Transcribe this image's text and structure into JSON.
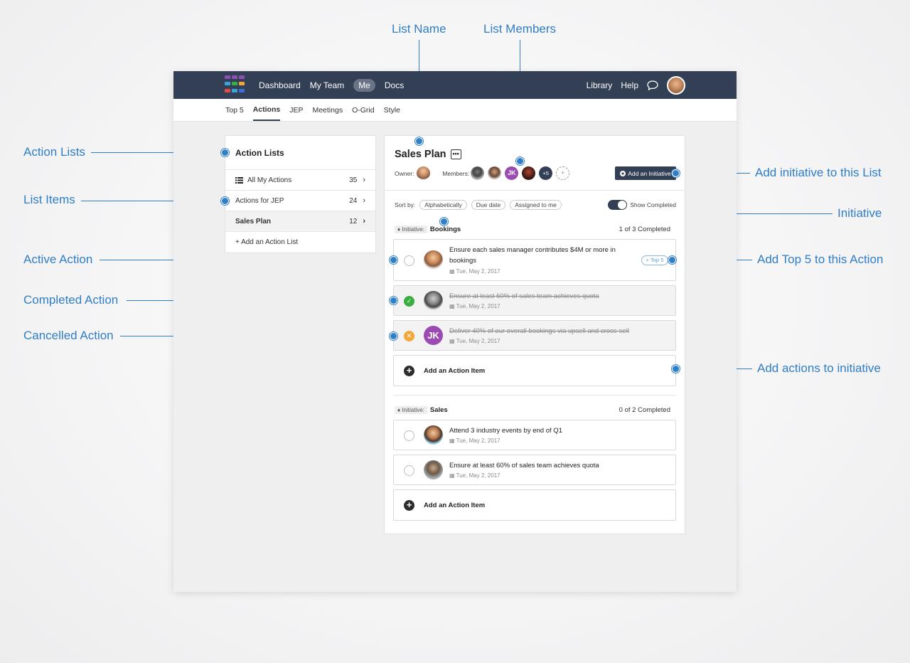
{
  "callouts": {
    "list_name": "List Name",
    "list_members": "List Members",
    "action_lists": "Action Lists",
    "list_items": "List Items",
    "active_action": "Active Action",
    "completed_action": "Completed Action",
    "cancelled_action": "Cancelled Action",
    "add_initiative": "Add initiative to this List",
    "initiative": "Initiative",
    "add_top5": "Add Top 5 to this Action",
    "add_actions": "Add actions to initiative"
  },
  "colors": {
    "accent": "#2f7ec6",
    "navbar": "#333f55",
    "complete": "#3aae3f",
    "cancel": "#f3a73a",
    "member_jk": "#9b4ab2"
  },
  "topnav": {
    "items": [
      "Dashboard",
      "My Team",
      "Me",
      "Docs"
    ],
    "active": "Me",
    "right": {
      "library": "Library",
      "help": "Help"
    }
  },
  "subnav": {
    "items": [
      "Top 5",
      "Actions",
      "JEP",
      "Meetings",
      "O-Grid",
      "Style"
    ],
    "active": "Actions"
  },
  "action_lists": {
    "title": "Action Lists",
    "items": [
      {
        "label": "All My Actions",
        "count": "35",
        "icon": "list-icon"
      },
      {
        "label": "Actions for JEP",
        "count": "24"
      },
      {
        "label": "Sales Plan",
        "count": "12",
        "selected": true
      }
    ],
    "add_label": "+ Add an Action List"
  },
  "list": {
    "name": "Sales Plan",
    "owner_label": "Owner:",
    "members_label": "Members:",
    "member_initials": "JK",
    "more_members": "+5",
    "add_initiative_label": "Add an Initiative",
    "sort_label": "Sort by:",
    "sort_options": [
      "Alphabetically",
      "Due date",
      "Assigned to me"
    ],
    "show_completed_label": "Show Completed",
    "show_completed_on": true
  },
  "initiatives": [
    {
      "tag": "Initiative:",
      "name": "Bookings",
      "status": "1 of 3 Completed",
      "actions": [
        {
          "text": "Ensure each sales manager contributes $4M or more in bookings",
          "date": "Tue, May 2, 2017",
          "state": "active",
          "top5_label": "+ Top 5"
        },
        {
          "text": "Ensure at least 60% of sales team achieves quota",
          "date": "Tue, May 2, 2017",
          "state": "completed"
        },
        {
          "text": "Deliver 40% of our overall bookings via upsell and cross-sell",
          "date": "Tue, May 2, 2017",
          "state": "cancelled",
          "initials": "JK"
        }
      ],
      "add_action_label": "Add an Action Item"
    },
    {
      "tag": "Initiative:",
      "name": "Sales",
      "status": "0 of 2 Completed",
      "actions": [
        {
          "text": "Attend 3 industry events by end of Q1",
          "date": "Tue, May 2, 2017",
          "state": "active"
        },
        {
          "text": "Ensure at least 60% of sales team achieves quota",
          "date": "Tue, May 2, 2017",
          "state": "active"
        }
      ],
      "add_action_label": "Add an Action Item"
    }
  ]
}
